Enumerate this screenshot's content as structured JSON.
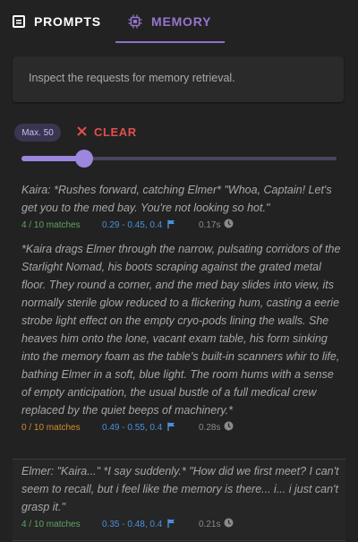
{
  "tabs": {
    "prompts_label": "PROMPTS",
    "memory_label": "MEMORY"
  },
  "info": {
    "text": "Inspect the requests for memory retrieval."
  },
  "controls": {
    "max_label": "Max. 50",
    "clear_label": "CLEAR",
    "slider_fraction": 0.2
  },
  "entries": [
    {
      "text": "Kaira: *Rushes forward, catching Elmer* \"Whoa, Captain! Let's get you to the med bay. You're not looking so hot.\"",
      "matches": "4 / 10 matches",
      "range": "0.29 - 0.45, 0.4",
      "time": "0.17s"
    },
    {
      "text": "*Kaira drags Elmer through the narrow, pulsating corridors of the Starlight Nomad, his boots scraping against the grated metal floor. They round a corner, and the med bay slides into view, its normally sterile glow reduced to a flickering hum, casting a eerie strobe light effect on the empty cryo-pods lining the walls. She heaves him onto the lone, vacant exam table, his form sinking into the memory foam as the table's built-in scanners whir to life, bathing Elmer in a soft, blue light. The room hums with a sense of empty anticipation, the usual bustle of a full medical crew replaced by the quiet beeps of machinery.*",
      "matches": "0 / 10 matches",
      "range": "0.49 - 0.55, 0.4",
      "time": "0.28s"
    },
    {
      "text": "Elmer: \"Kaira...\" *I say suddenly.* \"How did we first meet? I can't seem to recall, but i feel like the memory is there... i... i just can't grasp it.\"",
      "matches": "4 / 10 matches",
      "range": "0.35 - 0.48, 0.4",
      "time": "0.21s"
    }
  ],
  "colors": {
    "accent": "#8e70cf",
    "danger": "#e04f4f",
    "match_ok": "#5fa35f",
    "match_none": "#d48c2b",
    "range": "#4a90d9"
  },
  "icons": {
    "prompts": "document-icon",
    "memory": "chip-icon",
    "clear": "close-icon",
    "range": "flag-icon",
    "time": "clock-icon"
  }
}
